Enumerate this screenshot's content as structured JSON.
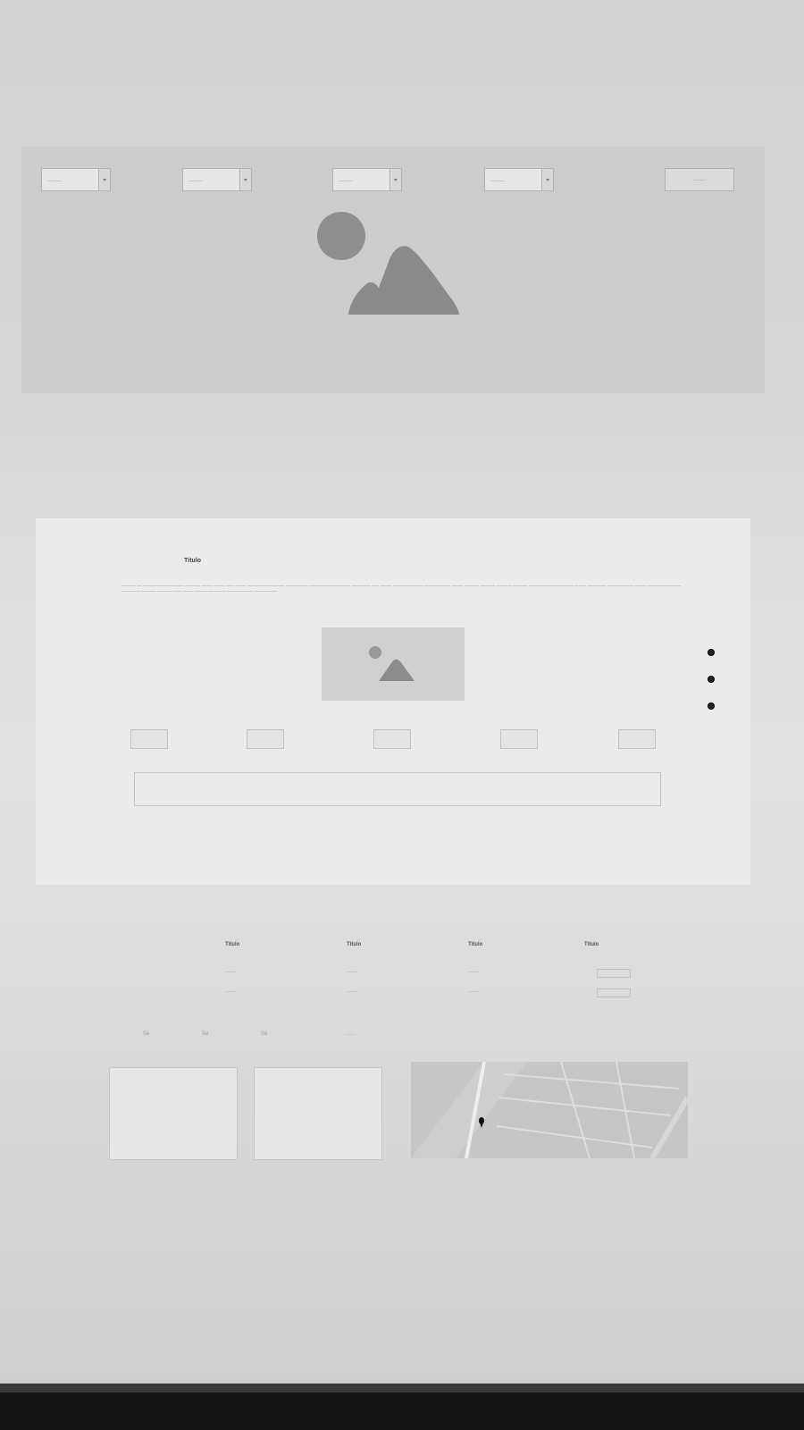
{
  "header": {
    "selects": [
      {
        "value": "————"
      },
      {
        "value": "————"
      },
      {
        "value": "————"
      },
      {
        "value": "————"
      }
    ],
    "button_label": "———"
  },
  "card": {
    "title": "Título",
    "body": "———— — ——————————— ———— ——— ——— —— ——— —————————— —————— ——————————— ————— —— ——— ———————— ——————— ——— ———— ———— ———— ———— ———————————— ——— ————— ——————— ——— ————————— ————— ———— ———— —— ——— ————— ——— ——————— ——————"
  },
  "columns": [
    {
      "title": "Título",
      "items": [
        "———",
        "———"
      ]
    },
    {
      "title": "Título",
      "items": [
        "———",
        "———"
      ]
    },
    {
      "title": "Título",
      "items": [
        "———",
        "———"
      ]
    },
    {
      "title": "Título",
      "items": [
        "",
        ""
      ]
    }
  ],
  "social": [
    "Se",
    "Se",
    "Se"
  ],
  "footer_text": "———",
  "colors": {
    "background": "#d8d8d8",
    "card": "#ebebeb",
    "placeholder": "#888888",
    "marker": "#111111"
  }
}
